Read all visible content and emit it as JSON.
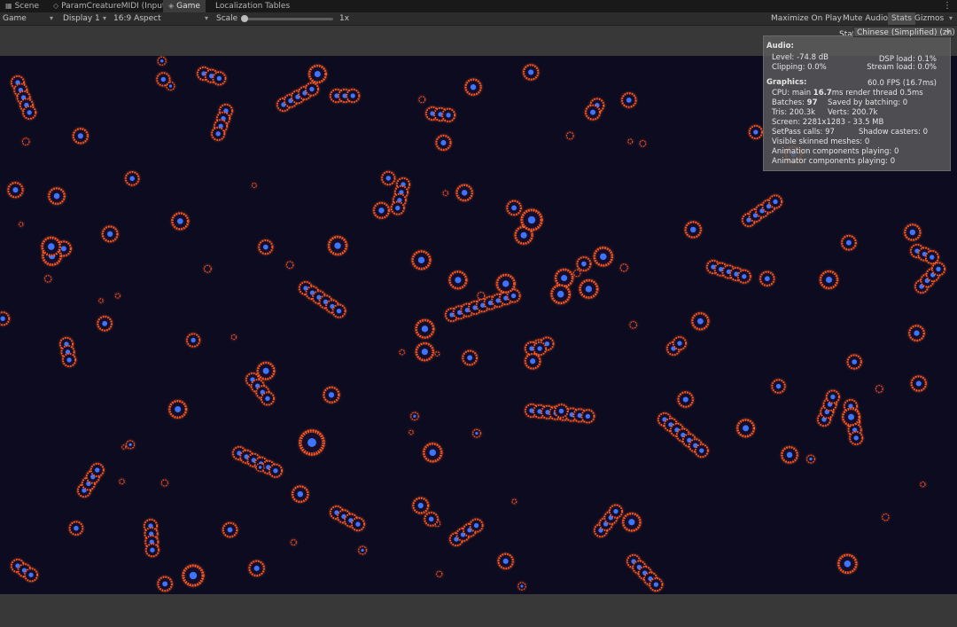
{
  "tabs": [
    {
      "label": "Scene",
      "icon": "grid-icon"
    },
    {
      "label": "ParamCreatureMIDI (Input…",
      "icon": "input-icon"
    },
    {
      "label": "Game",
      "icon": "gamepad-icon"
    },
    {
      "label": "Localization Tables",
      "icon": ""
    }
  ],
  "toolbar": {
    "game_view": "Game",
    "display": "Display 1",
    "aspect": "16:9 Aspect",
    "scale_label": "Scale",
    "scale_value": "1x",
    "maximize": "Maximize On Play",
    "mute": "Mute Audio",
    "stats": "Stats",
    "gizmos": "Gizmos"
  },
  "language": "Chinese (Simplified) (zh)",
  "stats_title": "Statistics",
  "stats": {
    "audio_heading": "Audio:",
    "level": "Level: -74.8 dB",
    "clipping": "Clipping: 0.0%",
    "dsp": "DSP load: 0.1%",
    "stream": "Stream load: 0.0%",
    "graphics_heading": "Graphics:",
    "fps": "60.0 FPS (16.7ms)",
    "cpu_a": "CPU: main ",
    "cpu_b": "16.7",
    "cpu_c": "ms  render thread 0.5ms",
    "batches_a": "Batches: ",
    "batches_b": "97",
    "saved": "Saved by batching: 0",
    "tris": "Tris: 200.3k",
    "verts": "Verts: 200.7k",
    "screen": "Screen: 2281x1283 - 33.5 MB",
    "setpass": "SetPass calls: 97",
    "shadow": "Shadow casters: 0",
    "skinned": "Visible skinned meshes: 0",
    "anim": "Animation components playing: 0",
    "animator": "Animator components playing: 0"
  },
  "colors": {
    "background": "#0d0b20",
    "membrane": "#ff5a1e",
    "nucleus": "#3d74ff"
  }
}
